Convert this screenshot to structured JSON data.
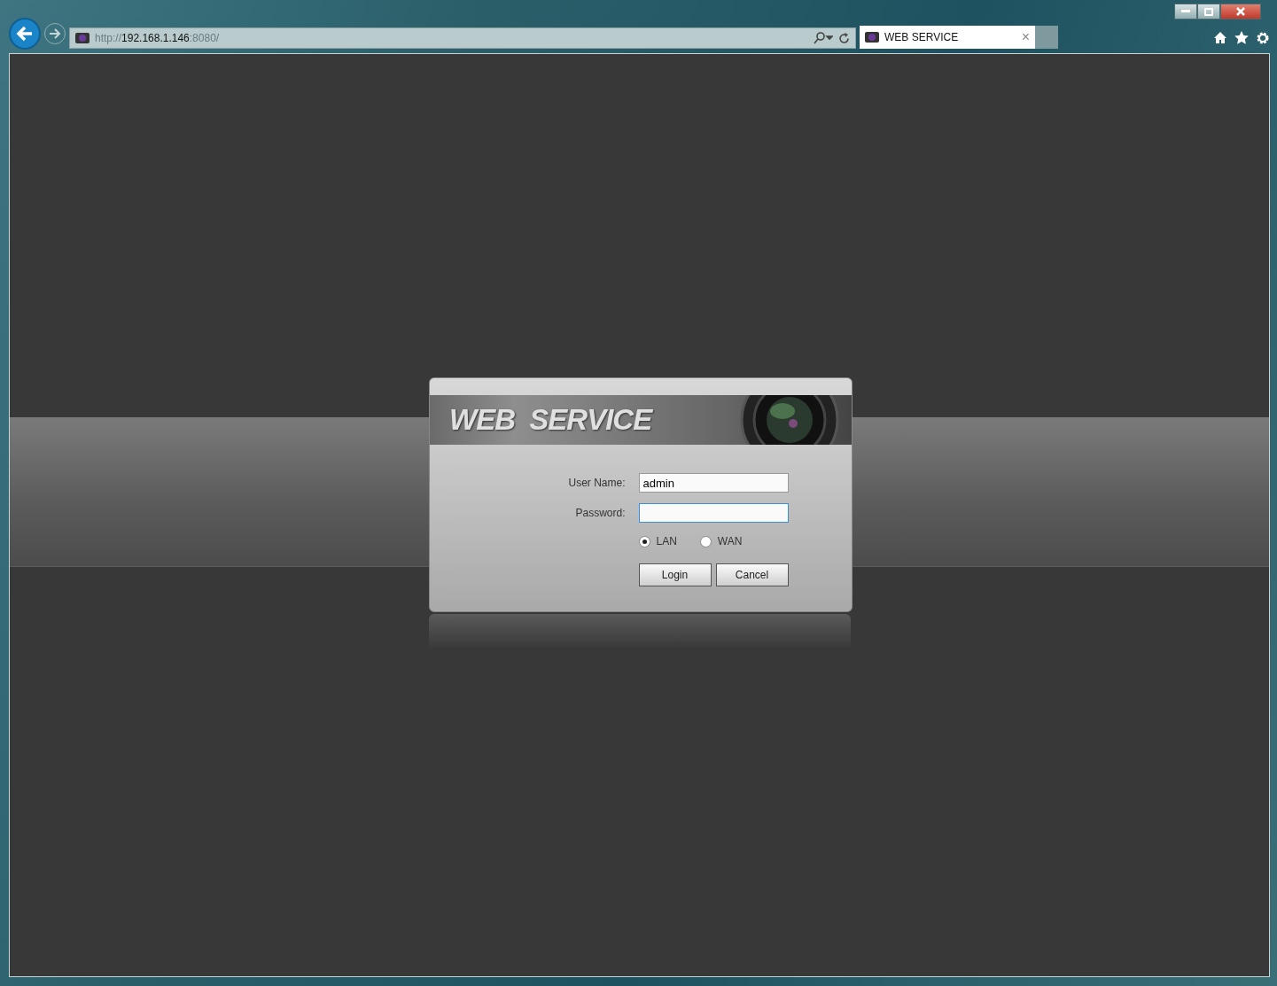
{
  "browser": {
    "url": {
      "scheme": "http://",
      "host": "192.168.1.146",
      "rest": ":8080/"
    },
    "tabs": [
      {
        "title": "WEB SERVICE",
        "selected": true
      }
    ],
    "close_glyph": "×"
  },
  "login": {
    "banner": "WEB  SERVICE",
    "fields": [
      {
        "label": "User Name:",
        "value": "admin",
        "focused": false
      },
      {
        "label": "Password:",
        "focused": true
      }
    ],
    "network": [
      {
        "label": "LAN",
        "selected": true
      },
      {
        "label": "WAN",
        "selected": false
      }
    ],
    "buttons": [
      "Login",
      "Cancel"
    ]
  }
}
